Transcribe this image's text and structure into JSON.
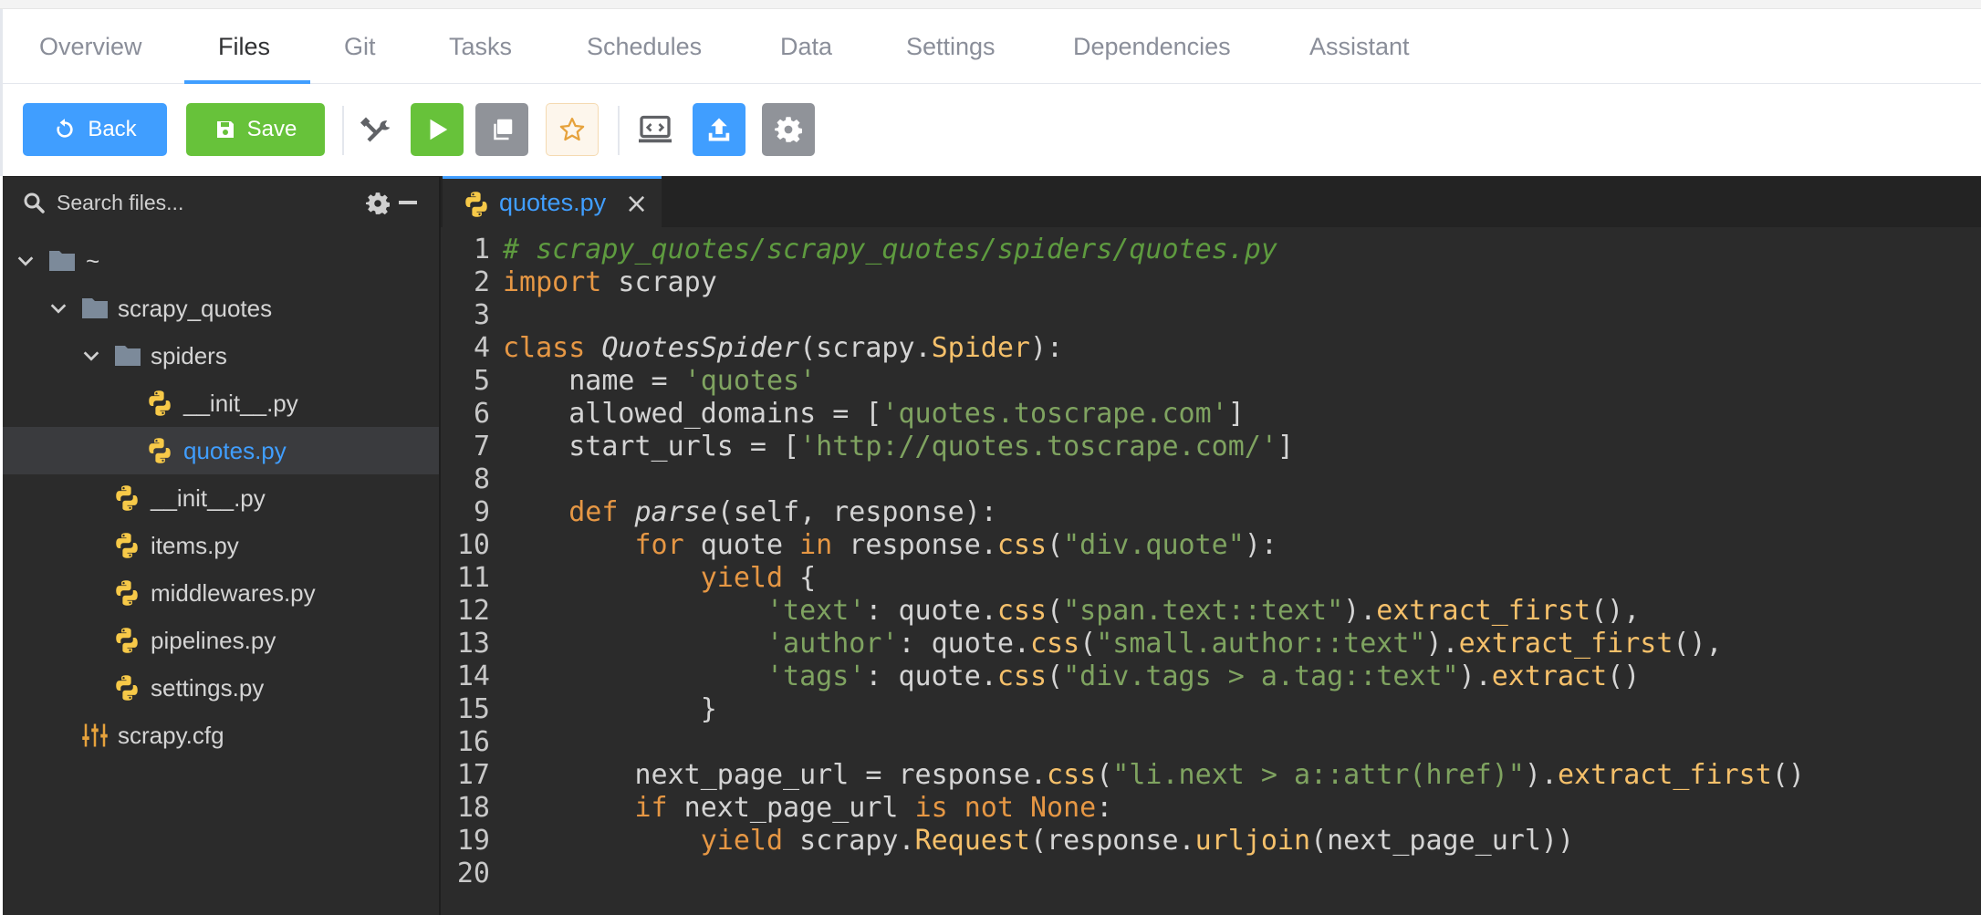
{
  "tabs": [
    {
      "label": "Overview"
    },
    {
      "label": "Files"
    },
    {
      "label": "Git"
    },
    {
      "label": "Tasks"
    },
    {
      "label": "Schedules"
    },
    {
      "label": "Data"
    },
    {
      "label": "Settings"
    },
    {
      "label": "Dependencies"
    },
    {
      "label": "Assistant"
    }
  ],
  "active_tab": "Files",
  "toolbar": {
    "back_label": "Back",
    "save_label": "Save",
    "icons": [
      "tools-icon",
      "run-icon",
      "copy-icon",
      "star-icon",
      "console-icon",
      "upload-icon",
      "settings-icon"
    ]
  },
  "colors": {
    "primary": "#409eff",
    "success": "#67c23a",
    "info": "#909399",
    "warning": "#e6a23c"
  },
  "sidebar": {
    "search_placeholder": "Search files...",
    "tree": [
      {
        "label": "~",
        "type": "folder",
        "expanded": true
      },
      {
        "label": "scrapy_quotes",
        "type": "folder",
        "expanded": true
      },
      {
        "label": "spiders",
        "type": "folder",
        "expanded": true
      },
      {
        "label": "__init__.py",
        "type": "python"
      },
      {
        "label": "quotes.py",
        "type": "python",
        "selected": true
      },
      {
        "label": "__init__.py",
        "type": "python"
      },
      {
        "label": "items.py",
        "type": "python"
      },
      {
        "label": "middlewares.py",
        "type": "python"
      },
      {
        "label": "pipelines.py",
        "type": "python"
      },
      {
        "label": "settings.py",
        "type": "python"
      },
      {
        "label": "scrapy.cfg",
        "type": "config"
      }
    ]
  },
  "editor": {
    "tab_label": "quotes.py",
    "lines": [
      [
        [
          "comment",
          "# scrapy_quotes/scrapy_quotes/spiders/quotes.py"
        ]
      ],
      [
        [
          "kw",
          "import"
        ],
        [
          "plain",
          " scrapy"
        ]
      ],
      [],
      [
        [
          "kw",
          "class"
        ],
        [
          "plain",
          " "
        ],
        [
          "cls",
          "QuotesSpider"
        ],
        [
          "plain",
          "(scrapy."
        ],
        [
          "fn",
          "Spider"
        ],
        [
          "plain",
          "):"
        ]
      ],
      [
        [
          "plain",
          "    name = "
        ],
        [
          "str",
          "'quotes'"
        ]
      ],
      [
        [
          "plain",
          "    allowed_domains = ["
        ],
        [
          "str",
          "'quotes.toscrape.com'"
        ],
        [
          "plain",
          "]"
        ]
      ],
      [
        [
          "plain",
          "    start_urls = ["
        ],
        [
          "str",
          "'http://quotes.toscrape.com/'"
        ],
        [
          "plain",
          "]"
        ]
      ],
      [],
      [
        [
          "plain",
          "    "
        ],
        [
          "kw",
          "def"
        ],
        [
          "plain",
          " "
        ],
        [
          "cls",
          "parse"
        ],
        [
          "plain",
          "(self, response):"
        ]
      ],
      [
        [
          "plain",
          "        "
        ],
        [
          "kw",
          "for"
        ],
        [
          "plain",
          " quote "
        ],
        [
          "kw",
          "in"
        ],
        [
          "plain",
          " response."
        ],
        [
          "fn",
          "css"
        ],
        [
          "plain",
          "("
        ],
        [
          "str",
          "\"div.quote\""
        ],
        [
          "plain",
          "):"
        ]
      ],
      [
        [
          "plain",
          "            "
        ],
        [
          "kw",
          "yield"
        ],
        [
          "plain",
          " {"
        ]
      ],
      [
        [
          "plain",
          "                "
        ],
        [
          "str",
          "'text'"
        ],
        [
          "plain",
          ": quote."
        ],
        [
          "fn",
          "css"
        ],
        [
          "plain",
          "("
        ],
        [
          "str",
          "\"span.text::text\""
        ],
        [
          "plain",
          ")."
        ],
        [
          "fn",
          "extract_first"
        ],
        [
          "plain",
          "(),"
        ]
      ],
      [
        [
          "plain",
          "                "
        ],
        [
          "str",
          "'author'"
        ],
        [
          "plain",
          ": quote."
        ],
        [
          "fn",
          "css"
        ],
        [
          "plain",
          "("
        ],
        [
          "str",
          "\"small.author::text\""
        ],
        [
          "plain",
          ")."
        ],
        [
          "fn",
          "extract_first"
        ],
        [
          "plain",
          "(),"
        ]
      ],
      [
        [
          "plain",
          "                "
        ],
        [
          "str",
          "'tags'"
        ],
        [
          "plain",
          ": quote."
        ],
        [
          "fn",
          "css"
        ],
        [
          "plain",
          "("
        ],
        [
          "str",
          "\"div.tags > a.tag::text\""
        ],
        [
          "plain",
          ")."
        ],
        [
          "fn",
          "extract"
        ],
        [
          "plain",
          "()"
        ]
      ],
      [
        [
          "plain",
          "            }"
        ]
      ],
      [],
      [
        [
          "plain",
          "        next_page_url = response."
        ],
        [
          "fn",
          "css"
        ],
        [
          "plain",
          "("
        ],
        [
          "str",
          "\"li.next > a::attr(href)\""
        ],
        [
          "plain",
          ")."
        ],
        [
          "fn",
          "extract_first"
        ],
        [
          "plain",
          "()"
        ]
      ],
      [
        [
          "plain",
          "        "
        ],
        [
          "kw",
          "if"
        ],
        [
          "plain",
          " next_page_url "
        ],
        [
          "kw",
          "is not None"
        ],
        [
          "plain",
          ":"
        ]
      ],
      [
        [
          "plain",
          "            "
        ],
        [
          "kw",
          "yield"
        ],
        [
          "plain",
          " scrapy."
        ],
        [
          "fn",
          "Request"
        ],
        [
          "plain",
          "(response."
        ],
        [
          "fn",
          "urljoin"
        ],
        [
          "plain",
          "(next_page_url))"
        ]
      ],
      []
    ]
  }
}
